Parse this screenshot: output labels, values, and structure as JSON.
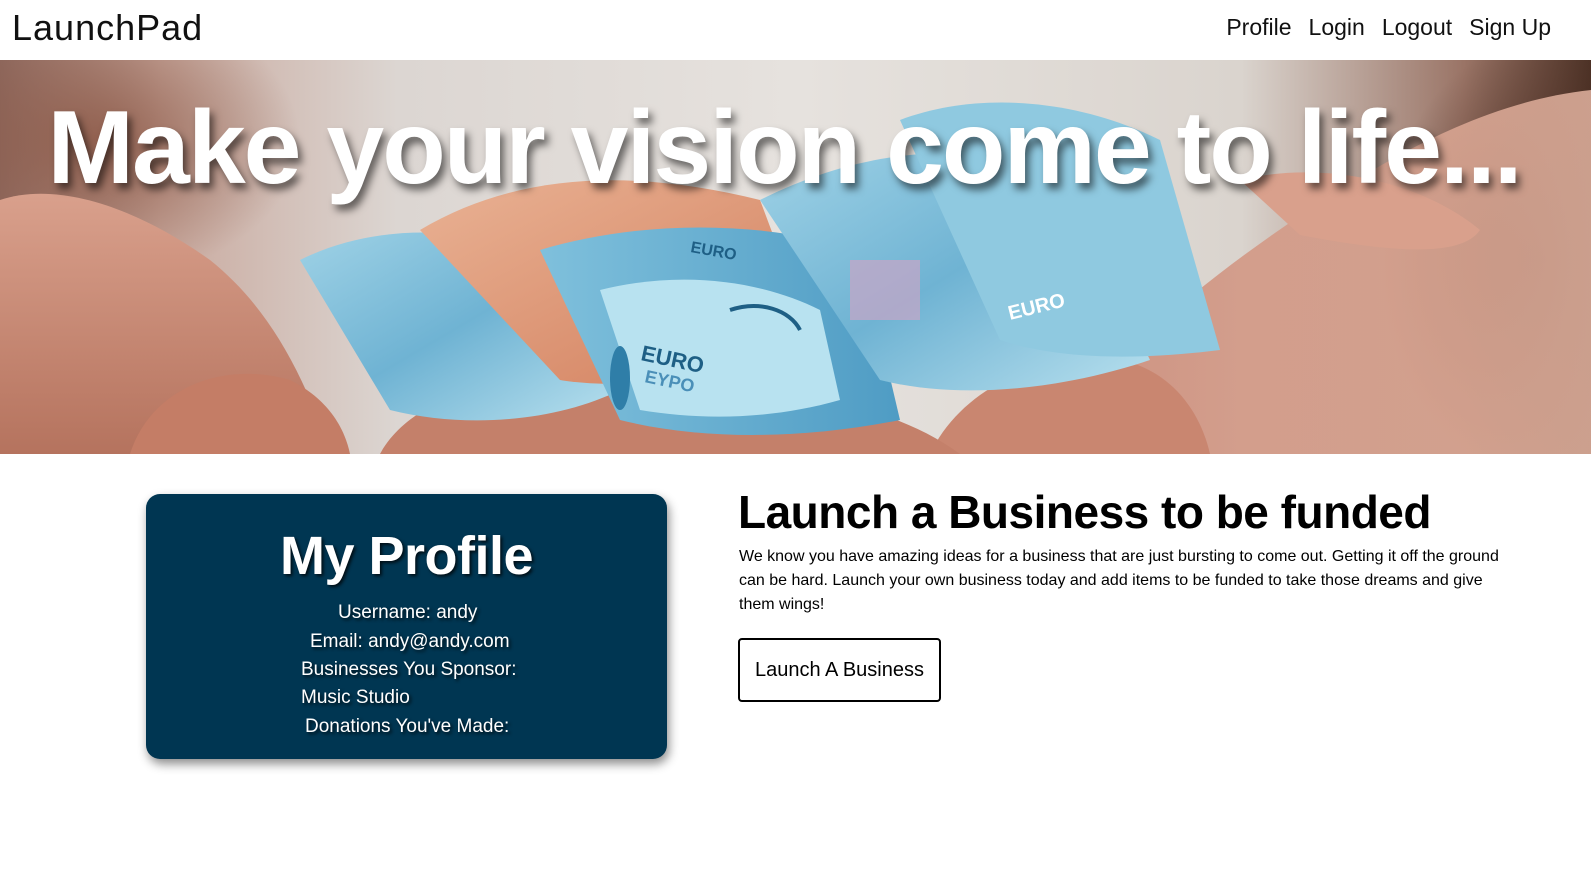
{
  "navbar": {
    "brand": "LaunchPad",
    "links": [
      {
        "label": "Profile"
      },
      {
        "label": "Login"
      },
      {
        "label": "Logout"
      },
      {
        "label": "Sign Up"
      }
    ]
  },
  "hero": {
    "headline": "Make your vision come to life...",
    "image_description_icon": "hands-holding-euro-banknotes-photo",
    "banknote_text": [
      "EURO",
      "EYPO",
      "EURO",
      "EURO"
    ]
  },
  "profile": {
    "title": "My Profile",
    "username_line": "Username: andy",
    "email_line": "Email: andy@andy.com",
    "sponsor_heading": "Businesses You Sponsor:",
    "sponsored_businesses": [
      "Music Studio"
    ],
    "donations_heading": "Donations You've Made:",
    "card_color": "#003652"
  },
  "launch": {
    "title": "Launch a Business to be funded",
    "description": "We know you have amazing ideas for a business that are just bursting to come out. Getting it off the ground can be hard. Launch your own business today and add items to be funded to take those dreams and give them wings!",
    "button_label": "Launch A Business"
  }
}
